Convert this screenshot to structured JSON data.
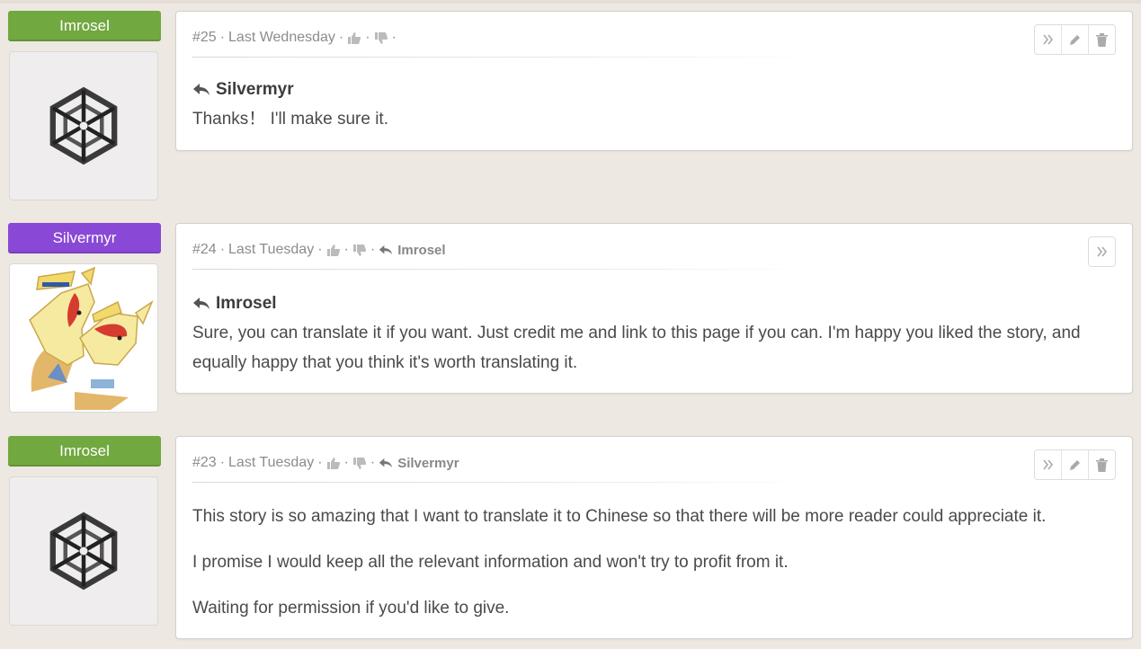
{
  "comments": [
    {
      "author": "Imrosel",
      "author_color": "#71a83f",
      "number": "#25",
      "time": "Last Wednesday",
      "reply_to_meta": "",
      "actions": [
        "»",
        "edit",
        "delete"
      ],
      "reply_to": "Silvermyr",
      "paragraphs": [
        "Thanks！ I'll make sure it."
      ]
    },
    {
      "author": "Silvermyr",
      "author_color": "#8a48d6",
      "number": "#24",
      "time": "Last Tuesday",
      "reply_to_meta": "Imrosel",
      "actions": [
        "»"
      ],
      "reply_to": "Imrosel",
      "paragraphs": [
        "Sure, you can translate it if you want. Just credit me and link to this page if you can. I'm happy you liked the story, and equally happy that you think it's worth translating it."
      ]
    },
    {
      "author": "Imrosel",
      "author_color": "#71a83f",
      "number": "#23",
      "time": "Last Tuesday",
      "reply_to_meta": "Silvermyr",
      "actions": [
        "»",
        "edit",
        "delete"
      ],
      "reply_to": "",
      "paragraphs": [
        "This story is so amazing that I want to translate it to Chinese so that there will be more reader could appreciate it.",
        "I promise I would keep all the relevant information and won't try to profit from it.",
        "Waiting for permission if you'd like to give."
      ]
    }
  ],
  "meta_separator": "·",
  "icons": {
    "like": "thumbs-up-icon",
    "dislike": "thumbs-down-icon",
    "reply": "reply-arrow-icon",
    "goto": "double-chevron-icon",
    "edit": "pencil-icon",
    "delete": "trash-icon"
  }
}
